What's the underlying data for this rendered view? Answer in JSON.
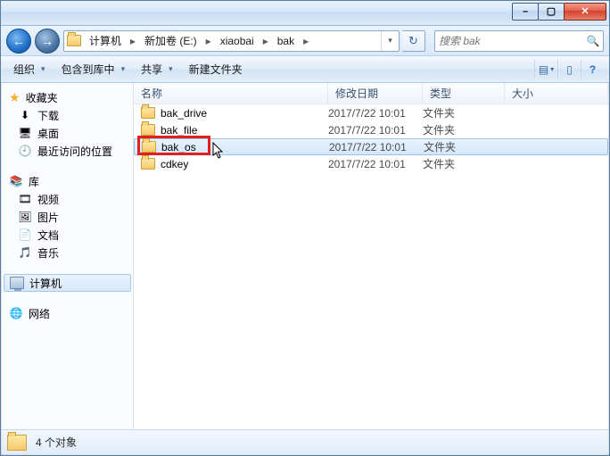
{
  "window": {
    "min_symbol": "–",
    "max_symbol": "▢",
    "close_symbol": "✕"
  },
  "nav": {
    "back_glyph": "←",
    "fwd_glyph": "→",
    "refresh_glyph": "↻"
  },
  "breadcrumbs": {
    "0": "计算机",
    "1": "新加卷 (E:)",
    "2": "xiaobai",
    "3": "bak"
  },
  "search": {
    "placeholder": "搜索 bak",
    "icon_glyph": "🔍"
  },
  "toolbar": {
    "organize": "组织",
    "include": "包含到库中",
    "share": "共享",
    "newfolder": "新建文件夹",
    "help_glyph": "?"
  },
  "tree": {
    "favorites": "收藏夹",
    "downloads": "下载",
    "desktop": "桌面",
    "recent": "最近访问的位置",
    "libraries": "库",
    "videos": "视频",
    "pictures": "图片",
    "documents": "文档",
    "music": "音乐",
    "computer": "计算机",
    "network": "网络"
  },
  "columns": {
    "name": "名称",
    "date": "修改日期",
    "type": "类型",
    "size": "大小"
  },
  "rows": [
    {
      "name": "bak_drive",
      "date": "2017/7/22 10:01",
      "type": "文件夹"
    },
    {
      "name": "bak_file",
      "date": "2017/7/22 10:01",
      "type": "文件夹"
    },
    {
      "name": "bak_os",
      "date": "2017/7/22 10:01",
      "type": "文件夹"
    },
    {
      "name": "cdkey",
      "date": "2017/7/22 10:01",
      "type": "文件夹"
    }
  ],
  "status": {
    "text": "4 个对象"
  }
}
